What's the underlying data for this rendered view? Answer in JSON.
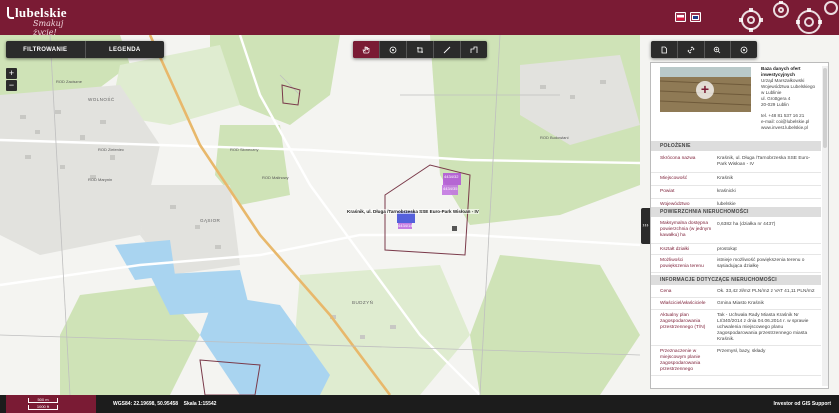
{
  "header": {
    "logo_main": "lubelskie",
    "logo_sub": "Smakuj życie!"
  },
  "left_toolbar": {
    "filter_label": "FILTROWANIE",
    "legend_label": "LEGENDA"
  },
  "zoom": {
    "in": "+",
    "out": "−"
  },
  "map_labels": {
    "wolnos": "WOLNOŚĆ",
    "budzyn": "BUDZYŃ",
    "gasior": "GĄSIOR",
    "rod_marynin": "ROD Marynin",
    "rod_sloneczny": "ROD Słoneczny",
    "rod_malinowy": "ROD Malinowy",
    "rod_zieleniec": "ROD Zieleniec",
    "rod_zaciszne": "ROD Zaciszne",
    "rod_budowlani": "ROD Budowlani"
  },
  "callout": "Kraśnik, ul. Długa /Tarnobrzeska SSE Euro-Park Wisłoan - IV",
  "parcel_labels": [
    "4434/32",
    "4434/35",
    "4434/14"
  ],
  "panel": {
    "info_title": "Baza danych ofert inwestycyjnych",
    "info_lines": [
      "Urząd Marszałkowski",
      "Województwa Lubelskiego",
      "w Lublinie",
      "ul. Grottgera 4",
      "20-029 Lublin",
      "",
      "tel. +48 81 537 16 21",
      "e-mail: coi@lubelskie.pl",
      "www.invest.lubelskie.pl"
    ],
    "sections": {
      "location": "POŁOŻENIE",
      "area": "POWIERZCHNIA NIERUCHOMOŚCI",
      "info": "INFORMACJE DOTYCZĄCE NIERUCHOMOŚCI"
    },
    "rows": [
      {
        "label": "Skrócona nazwa",
        "value": "Kraśnik, ul. Długa /Tarnobrzeska SSE Euro-Park Wisłoan - IV"
      },
      {
        "label": "Miejscowość",
        "value": "Kraśnik"
      },
      {
        "label": "Powiat",
        "value": "kraśnicki"
      },
      {
        "label": "Województwo",
        "value": "lubelskie"
      },
      {
        "label": "Maksymalna dostępna powierzchnia (w jednym kawałku) ha",
        "value": "0,6382 ha (działka nr 4437)"
      },
      {
        "label": "Kształt działki",
        "value": "prostokąt"
      },
      {
        "label": "Możliwości powiększenia terenu",
        "value": "istnieje możliwość powiększenia terenu o sąsiadująca działkę"
      },
      {
        "label": "Cena",
        "value": "Ok. 33,42 zł/m2 PLN/m2 z VAT 41,11 PLN/m2"
      },
      {
        "label": "Właściciel/właściciele",
        "value": "Gmina Miasto Kraśnik"
      },
      {
        "label": "Aktualny plan zagospodarowania przestrzennego (T/N)",
        "value": "Tak - Uchwała Rady Miasta Kraśnik Nr LI/340/2014 z dnia 04.06.2014 r. w sprawie uchwalenia miejscowego planu zagospodarowania przestrzennego miasta Kraśnik."
      },
      {
        "label": "Przeznaczenie w miejscowym planie zagospodarowania przestrzennego",
        "value": "Przemysł, bazy, składy"
      }
    ]
  },
  "footer": {
    "scale_top": "500 m",
    "scale_bottom": "1000 ft",
    "coords": "WGS84: 22.19698, 50.95458",
    "scale_label": "Skala 1:15542",
    "credit": "Investor od GIS Support"
  },
  "colors": {
    "brand": "#7a1b34",
    "toolbar": "#2b2b2b"
  }
}
